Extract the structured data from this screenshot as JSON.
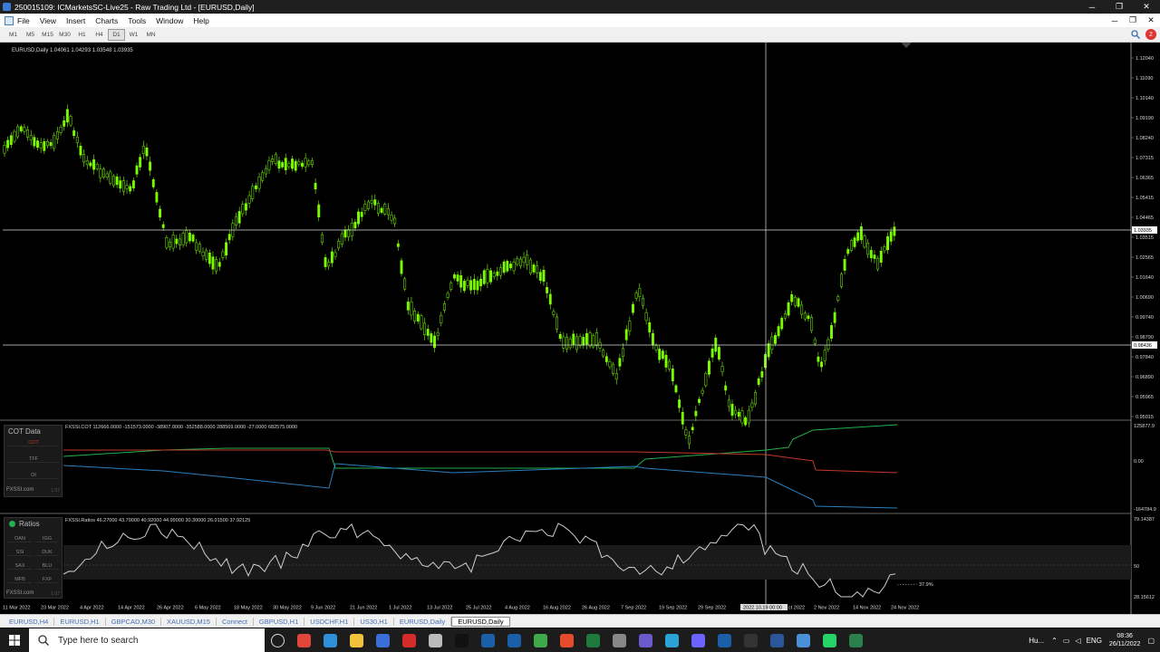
{
  "window": {
    "title": "250015109: ICMarketsSC-Live25 - Raw Trading Ltd - [EURUSD,Daily]",
    "controls": [
      "─",
      "❐",
      "✕"
    ]
  },
  "menu": {
    "items": [
      "File",
      "View",
      "Insert",
      "Charts",
      "Tools",
      "Window",
      "Help"
    ],
    "right_controls": [
      "─",
      "❐",
      "✕"
    ]
  },
  "timeframes": {
    "items": [
      "M1",
      "M5",
      "M15",
      "M30",
      "H1",
      "H4",
      "D1",
      "W1",
      "MN"
    ],
    "active": "D1",
    "notification_count": "2"
  },
  "chart": {
    "header": "EURUSD,Daily  1.04061 1.04293 1.03548 1.03935",
    "price_labels": [
      "1.12040",
      "1.11090",
      "1.10140",
      "1.09190",
      "1.08240",
      "1.07315",
      "1.06365",
      "1.05415",
      "1.04465",
      "1.03515",
      "1.02565",
      "1.01640",
      "1.00690",
      "0.99740",
      "0.98790",
      "0.97840",
      "0.96890",
      "0.95965",
      "0.95015"
    ],
    "current_price_tag": "1.03935",
    "crosshair_price_tag": "0.98436",
    "date_labels": [
      "11 Mar 2022",
      "23 Mar 2022",
      "4 Apr 2022",
      "14 Apr 2022",
      "26 Apr 2022",
      "6 May 2022",
      "18 May 2022",
      "30 May 2022",
      "9 Jun 2022",
      "21 Jun 2022",
      "1 Jul 2022",
      "13 Jul 2022",
      "25 Jul 2022",
      "4 Aug 2022",
      "16 Aug 2022",
      "26 Aug 2022",
      "7 Sep 2022",
      "19 Sep 2022",
      "29 Sep 2022",
      "2 Nov 2022",
      "14 Nov 2022",
      "24 Nov 2022"
    ],
    "crosshair_date_tag": "2022.10.19 00:00",
    "crosshair_date_tail": "ct 2022",
    "candle_color": "#7CFC00",
    "line_color": "#ffffff"
  },
  "cot": {
    "panel_title": "COT Data",
    "buttons": [
      "COT",
      "TFF",
      "OI"
    ],
    "brand": "FXSSI.com",
    "version": "1.07",
    "indicator_header": "FXSSI.COT 112666.0000 -151573.0000 -38907.0000 -352588.0000 288569.0000 -27.0000 682575.0000",
    "scale_top": "125877.9",
    "scale_mid": "0.00",
    "scale_bottom": "-164784.9",
    "colors": {
      "green": "#22b14c",
      "red": "#c0392b",
      "blue": "#2a7fbf"
    }
  },
  "ratios": {
    "panel_title": "Ratios",
    "buttons": [
      "OAN",
      "IGG",
      "SSI",
      "DUK",
      "SAX",
      "BLU",
      "MFB",
      "FXF"
    ],
    "brand": "FXSSI.com",
    "version": "1.07",
    "indicator_header": "FXSSI.Ratios 46.27000 43.79000 40.92000 44.99000 30.30000 26.01500 37.92125",
    "scale_top": "79.14387",
    "scale_mid": "50",
    "scale_bottom": "28.15612",
    "last_value": "37.9%"
  },
  "tabs": {
    "items": [
      "EURUSD,H4",
      "EURUSD,H1",
      "GBPCAD,M30",
      "XAUUSD,M15",
      "Connect",
      "GBPUSD,H1",
      "USDCHF,H1",
      "US30,H1",
      "EURUSD,Daily",
      "EURUSD,Daily"
    ],
    "active_index": 9
  },
  "taskbar": {
    "search_placeholder": "Type here to search",
    "language": "ENG",
    "time": "08:36",
    "date": "26/11/2022",
    "pinned_icons": [
      "task-view-icon",
      "chrome-icon",
      "edge-icon",
      "file-explorer-icon",
      "mail-icon",
      "opera-icon",
      "store-icon",
      "tradingview-icon",
      "metatrader-icon",
      "metatrader-icon-2",
      "ccleaner-icon",
      "office-icon",
      "excel-icon",
      "calculator-icon",
      "paint-icon",
      "telegram-icon",
      "discord-icon",
      "outlook-icon",
      "obs-icon",
      "word-icon",
      "kite-icon",
      "whatsapp-icon",
      "mt4-icon"
    ],
    "tray_label": "Hu..."
  }
}
